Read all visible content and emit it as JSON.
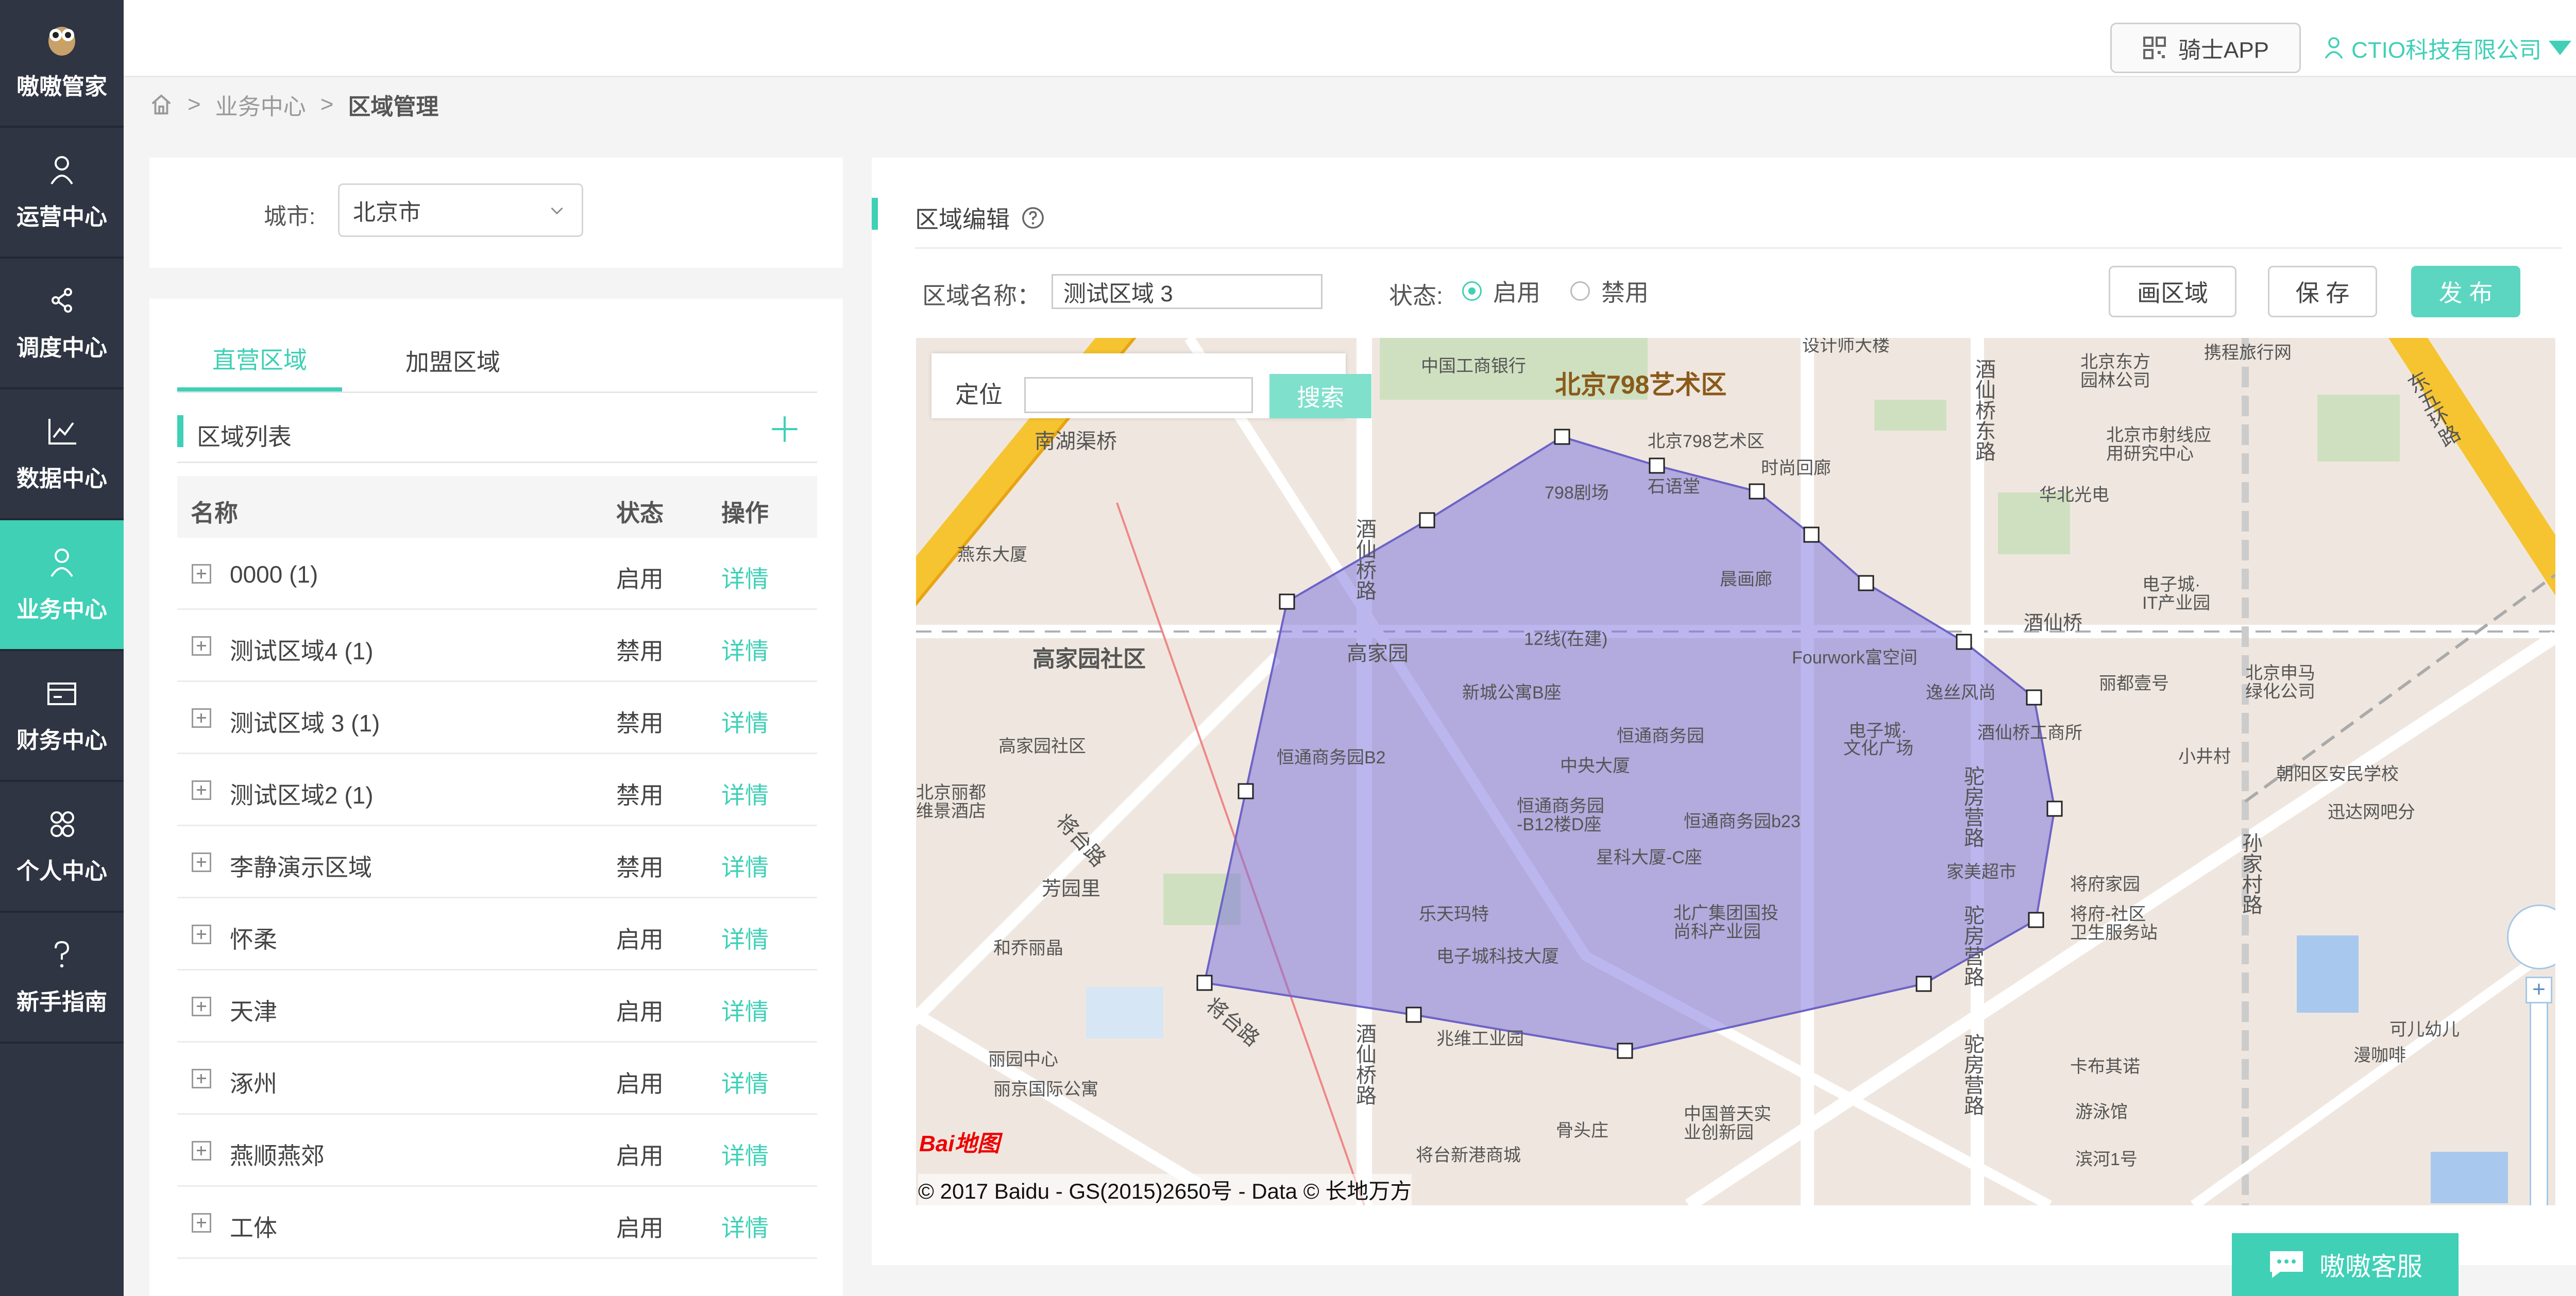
{
  "sidebar": {
    "app_name": "嗷嗷管家",
    "items": [
      {
        "label": "运营中心",
        "icon": "person-icon"
      },
      {
        "label": "调度中心",
        "icon": "share-nodes-icon"
      },
      {
        "label": "数据中心",
        "icon": "line-chart-icon"
      },
      {
        "label": "业务中心",
        "icon": "person-icon",
        "active": true
      },
      {
        "label": "财务中心",
        "icon": "wallet-icon"
      },
      {
        "label": "个人中心",
        "icon": "group-icon"
      },
      {
        "label": "新手指南",
        "icon": "question-icon"
      }
    ]
  },
  "topbar": {
    "app_button": "骑士APP",
    "company": "CTIO科技有限公司"
  },
  "breadcrumb": {
    "items": [
      "业务中心"
    ],
    "current": "区域管理"
  },
  "city": {
    "label": "城市:",
    "value": "北京市"
  },
  "tabs": [
    {
      "label": "直营区域",
      "active": true
    },
    {
      "label": "加盟区域",
      "active": false
    }
  ],
  "area_list": {
    "title": "区域列表",
    "columns": [
      "名称",
      "状态",
      "操作"
    ],
    "rows": [
      {
        "name": "0000 (1)",
        "status": "启用",
        "action": "详情"
      },
      {
        "name": "测试区域4 (1)",
        "status": "禁用",
        "action": "详情"
      },
      {
        "name": "测试区域 3 (1)",
        "status": "禁用",
        "action": "详情"
      },
      {
        "name": "测试区域2 (1)",
        "status": "禁用",
        "action": "详情"
      },
      {
        "name": "李静演示区域",
        "status": "禁用",
        "action": "详情"
      },
      {
        "name": "怀柔",
        "status": "启用",
        "action": "详情"
      },
      {
        "name": "天津",
        "status": "启用",
        "action": "详情"
      },
      {
        "name": "涿州",
        "status": "启用",
        "action": "详情"
      },
      {
        "name": "燕顺燕郊",
        "status": "启用",
        "action": "详情"
      },
      {
        "name": "工体",
        "status": "启用",
        "action": "详情"
      }
    ]
  },
  "editor": {
    "title": "区域编辑",
    "name_label": "区域名称：",
    "name_value": "测试区域 3",
    "status_label": "状态:",
    "status_options": [
      {
        "label": "启用",
        "selected": true
      },
      {
        "label": "禁用",
        "selected": false
      }
    ],
    "draw_button": "画区域",
    "save_button": "保 存",
    "publish_button": "发 布"
  },
  "map": {
    "locate_label": "定位",
    "search_button": "搜索",
    "copyright": "© 2017 Baidu - GS(2015)2650号 - Data © 长地万方",
    "logo": "Bai地图",
    "labels": [
      "北京798艺术区",
      "中国工商银行",
      "设计师大楼",
      "北京798艺术区",
      "798剧场",
      "石语堂",
      "时尚回廊",
      "晨画廊",
      "南湖渠桥",
      "燕东大厦",
      "高家园社区",
      "高家园社区",
      "高家园",
      "12线(在建)",
      "Fourwork富空间",
      "新城公寓B座",
      "恒通商务园",
      "恒通商务园B2",
      "中央大厦",
      "恒通商务园-B12楼D座",
      "恒通商务园b23",
      "星科大厦-C座",
      "电子城·文化广场",
      "逸丝风尚",
      "酒仙桥工商所",
      "酒仙桥",
      "驼房营路",
      "家美超市",
      "将府家园",
      "将府-社区卫生服务站",
      "乐天玛特",
      "电子城科技大厦",
      "北广集团国投尚科产业园",
      "芳园里",
      "和乔丽晶",
      "将台路",
      "兆维工业园",
      "酒仙桥路",
      "丽园中心",
      "丽京国际公寓",
      "将台新港商城",
      "中国普天实业创新园",
      "骨头庄",
      "卡布其诺",
      "游泳馆",
      "滨河1号",
      "北京东方园林公司",
      "携程旅行网",
      "北京市射线应用研究中心",
      "华北光电",
      "电子城·IT产业园",
      "丽都壹号",
      "北京申马绿化公司",
      "小井村",
      "朝阳区安民学校",
      "迅达网吧分",
      "孙家村路",
      "东五环路",
      "北京丽都维景酒店",
      "酒仙桥东路",
      "漫咖啡",
      "可儿幼儿"
    ]
  },
  "customer_service": "嗷嗷客服"
}
